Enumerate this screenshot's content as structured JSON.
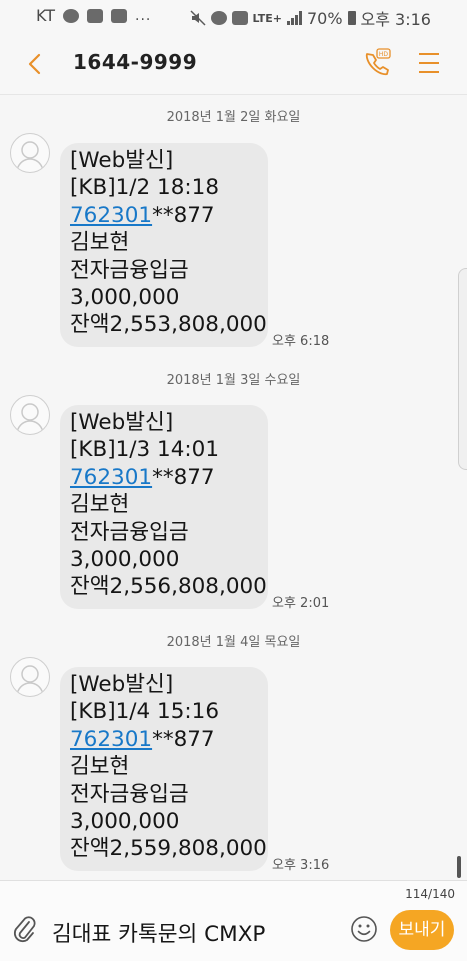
{
  "status_bar": {
    "carrier": "KT",
    "more": "...",
    "battery": "70%",
    "time": "오후 3:16",
    "network": "LTE+"
  },
  "header": {
    "title": "1644-9999",
    "accent_color": "#e8902a"
  },
  "messages": [
    {
      "date": "2018년 1월 2일 화요일",
      "lines": [
        "[Web발신]",
        "[KB]1/2 18:18",
        "**877",
        "김보현",
        "전자금융입금",
        "3,000,000",
        "잔액2,553,808,000"
      ],
      "account_link": "762301",
      "time": "오후 6:18"
    },
    {
      "date": "2018년 1월 3일 수요일",
      "lines": [
        "[Web발신]",
        "[KB]1/3 14:01",
        "**877",
        "김보현",
        "전자금융입금",
        "3,000,000",
        "잔액2,556,808,000"
      ],
      "account_link": "762301",
      "time": "오후 2:01"
    },
    {
      "date": "2018년 1월 4일 목요일",
      "lines": [
        "[Web발신]",
        "[KB]1/4 15:16",
        "**877",
        "김보현",
        "전자금융입금",
        "3,000,000",
        "잔액2,559,808,000"
      ],
      "account_link": "762301",
      "time": "오후 3:16"
    }
  ],
  "composer": {
    "counter": "114/140",
    "input_value": "김대표 카톡문의 CMXP",
    "send_label": "보내기",
    "send_color": "#f5a623"
  }
}
